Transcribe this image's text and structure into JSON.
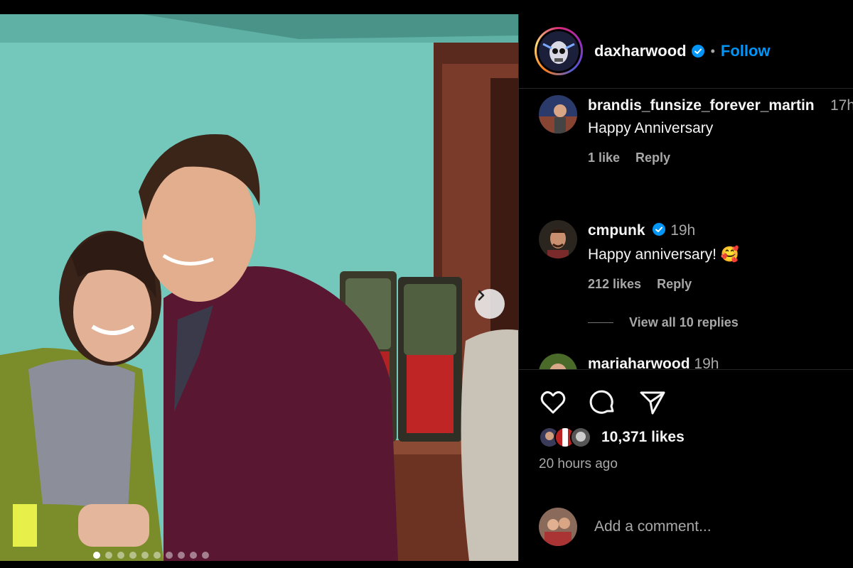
{
  "post": {
    "owner": "daxharwood",
    "separator": "•",
    "follow_label": "Follow",
    "carousel": {
      "count": 10,
      "active_index": 0
    }
  },
  "comments": [
    {
      "user": "brandis_funsize_forever_martin",
      "time": "17h",
      "text": "Happy Anniversary",
      "likes": "1 like",
      "reply": "Reply"
    },
    {
      "user": "cmpunk",
      "verified": true,
      "time": "19h",
      "text": "Happy anniversary! 🥰",
      "likes": "212 likes",
      "reply": "Reply",
      "view_replies": "View all 10 replies"
    },
    {
      "user": "mariaharwood",
      "time": "19h"
    }
  ],
  "footer": {
    "likes": "10,371 likes",
    "time_ago": "20 hours ago",
    "comment_placeholder": "Add a comment..."
  },
  "colors": {
    "accent": "#0095f6",
    "muted": "#a8a8a8",
    "background": "#000000"
  },
  "icons": [
    "heart-icon",
    "comment-icon",
    "share-icon",
    "verified-icon",
    "chevron-right-icon"
  ]
}
